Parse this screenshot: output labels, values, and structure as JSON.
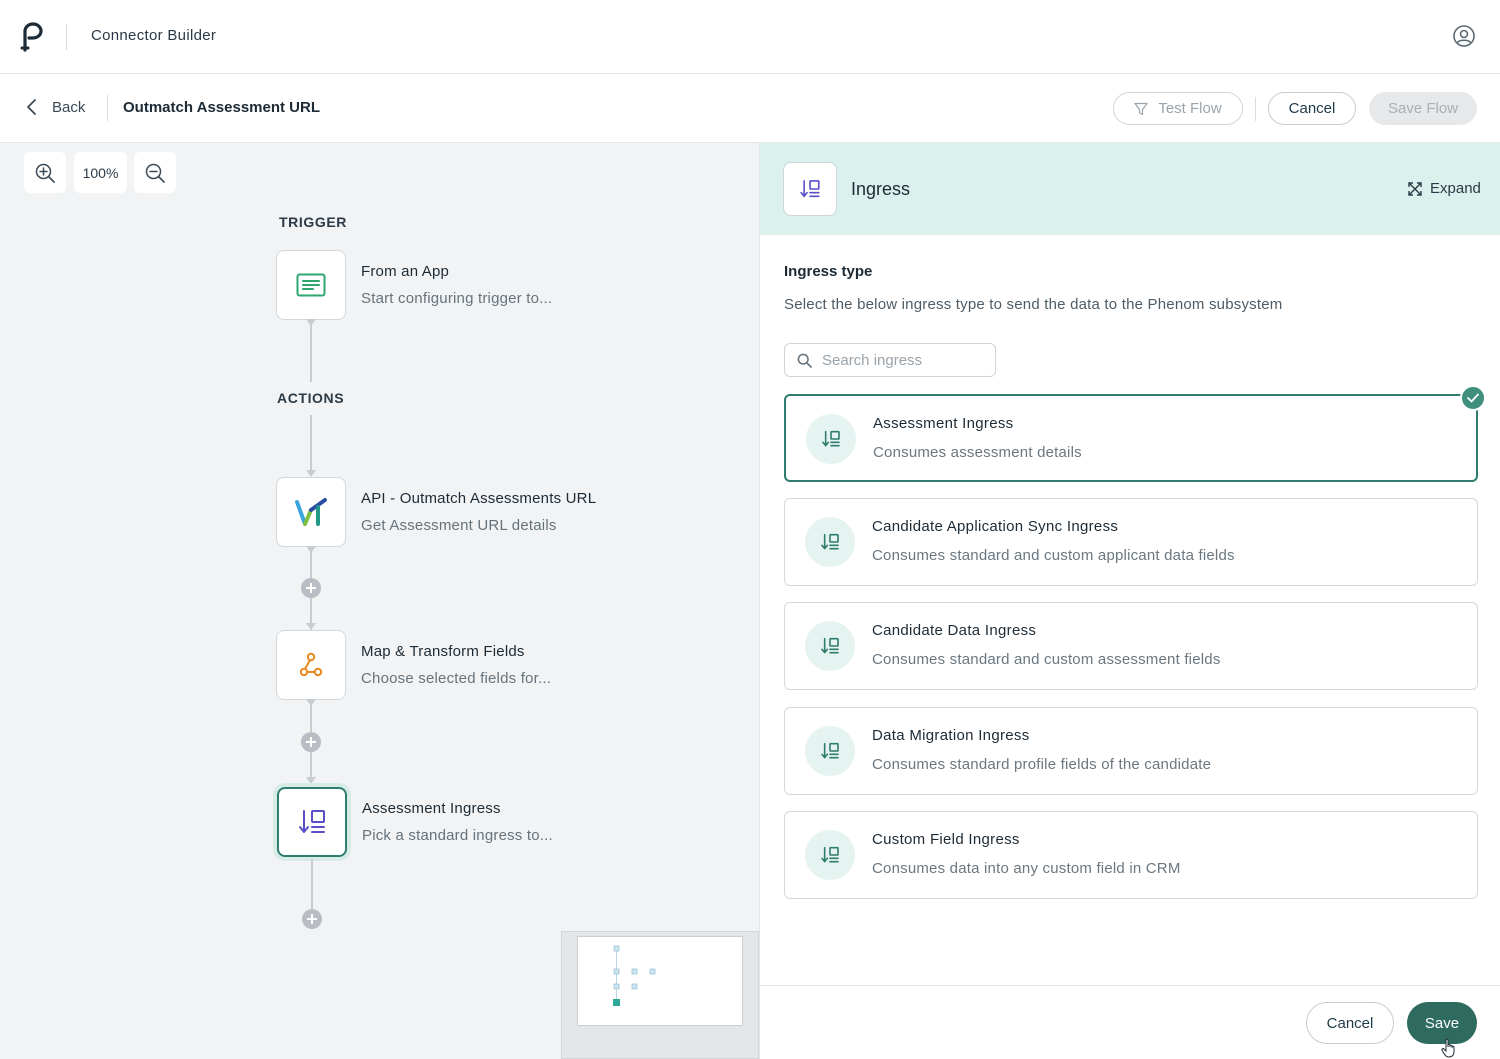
{
  "header": {
    "app_title": "Connector Builder"
  },
  "subheader": {
    "back_label": "Back",
    "flow_title": "Outmatch Assessment URL",
    "test_flow_label": "Test Flow",
    "cancel_label": "Cancel",
    "save_flow_label": "Save Flow"
  },
  "canvas": {
    "zoom_level": "100%",
    "trigger_label": "TRIGGER",
    "actions_label": "ACTIONS",
    "nodes": [
      {
        "title": "From an App",
        "subtitle": "Start configuring trigger to...",
        "icon": "form-icon"
      },
      {
        "title": "API - Outmatch Assessments URL",
        "subtitle": "Get Assessment URL details",
        "icon": "outmatch-logo-icon"
      },
      {
        "title": "Map & Transform Fields",
        "subtitle": "Choose selected fields for...",
        "icon": "transform-icon"
      },
      {
        "title": "Assessment Ingress",
        "subtitle": "Pick a standard ingress to...",
        "icon": "ingress-icon"
      }
    ]
  },
  "panel": {
    "title": "Ingress",
    "expand_label": "Expand",
    "ingress_type_label": "Ingress type",
    "ingress_type_desc": "Select the below ingress type to send the data to the Phenom subsystem",
    "search_placeholder": "Search ingress",
    "options": [
      {
        "title": "Assessment Ingress",
        "subtitle": "Consumes assessment details",
        "selected": true
      },
      {
        "title": "Candidate Application Sync Ingress",
        "subtitle": "Consumes standard and custom applicant data fields",
        "selected": false
      },
      {
        "title": "Candidate Data Ingress",
        "subtitle": "Consumes standard and custom assessment fields",
        "selected": false
      },
      {
        "title": "Data Migration Ingress",
        "subtitle": "Consumes standard profile fields of the candidate",
        "selected": false
      },
      {
        "title": "Custom Field Ingress",
        "subtitle": "Consumes data into any custom field in CRM",
        "selected": false
      }
    ],
    "cancel_label": "Cancel",
    "save_label": "Save"
  },
  "colors": {
    "accent": "#2e6b5e",
    "panel_header_bg": "#dbf1ee",
    "selected_border": "#2f7d6f",
    "icon_purple": "#6b5bd6",
    "trigger_green": "#2ea66f",
    "transform_orange": "#e98a1f"
  }
}
